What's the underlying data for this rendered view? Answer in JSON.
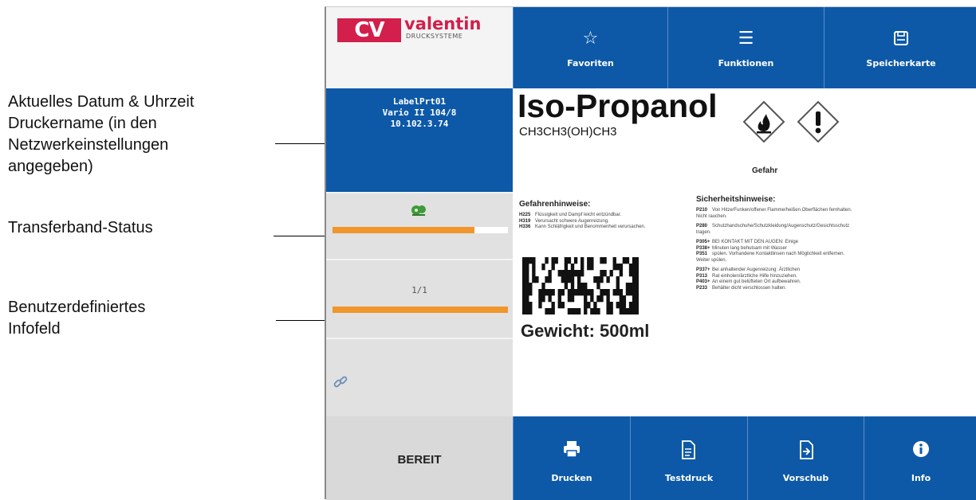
{
  "annotations": [
    {
      "lines": [
        "Aktuelles Datum & Uhrzeit",
        "Druckername (in den",
        "Netzwerkeinstellungen",
        "angegeben)"
      ]
    },
    {
      "lines": [
        "Transferband-Status"
      ]
    },
    {
      "lines": [
        "Benutzerdefiniertes",
        "Infofeld"
      ]
    }
  ],
  "logo": {
    "mark": "CV",
    "name": "valentin",
    "subtitle": "DRUCKSYSTEME",
    "color": "#d21f4b"
  },
  "top_buttons": [
    {
      "label": "Favoriten",
      "icon": "star-icon"
    },
    {
      "label": "Funktionen",
      "icon": "list-icon"
    },
    {
      "label": "Speicherkarte",
      "icon": "memory-card-icon"
    }
  ],
  "printer_info": {
    "name": "LabelPrt01",
    "model": "Vario II 104/8",
    "ip": "10.102.3.74"
  },
  "ribbon_status": {
    "icon": "ribbon-icon",
    "level": 0.81
  },
  "info_field": {
    "counter": "1/1",
    "progress": 1.0
  },
  "link_icon": "link-icon",
  "status": {
    "text": "BEREIT"
  },
  "label_preview": {
    "title": "Iso-Propanol",
    "formula": "CH3CH3(OH)CH3",
    "pictograms": [
      "flame-pictogram-icon",
      "exclamation-pictogram-icon"
    ],
    "signal_word": "Gefahr",
    "hazard_heading": "Gefahrenhinweise:",
    "hazard_statements": [
      {
        "code": "H225",
        "text": "Flüssigkeit und Dampf leicht entzündbar."
      },
      {
        "code": "H319",
        "text": "Verursacht schwere Augenreizung."
      },
      {
        "code": "H336",
        "text": "Kann Schläfrigkeit und Benommenheit verursachen."
      }
    ],
    "safety_heading": "Sicherheitshinweise:",
    "safety_statements": [
      {
        "code": "P210",
        "text": "Von Hitze/Funken/offener Flamme/heißen Oberflächen fernhalten. Nicht rauchen."
      },
      {
        "code": "P280",
        "text": "Schutzhandschuhe/Schutzkleidung/Augenschutz/Gesichtsschutz tragen."
      },
      {
        "code": "P305+",
        "text": "BEI KONTAKT MIT DEN AUGEN: Einige"
      },
      {
        "code": "P338+",
        "text": "Minuten lang behutsam mit Wasser"
      },
      {
        "code": "P351",
        "text": "spülen. Vorhandene Kontaktlinsen nach Möglichkeit entfernen. Weiter spülen."
      },
      {
        "code": "P337+",
        "text": "Bei anhaltender Augenreizung: Ärztlichen"
      },
      {
        "code": "P313",
        "text": "Rat einholen/ärztliche Hilfe hinzuziehen."
      },
      {
        "code": "P403+",
        "text": "An einem gut belüfteten Ort aufbewahren."
      },
      {
        "code": "P233",
        "text": "Behälter dicht verschlossen halten."
      }
    ],
    "weight": "Gewicht: 500ml"
  },
  "bottom_buttons": [
    {
      "label": "Drucken",
      "icon": "printer-icon"
    },
    {
      "label": "Testdruck",
      "icon": "test-print-icon"
    },
    {
      "label": "Vorschub",
      "icon": "feed-icon"
    },
    {
      "label": "Info",
      "icon": "info-icon"
    }
  ],
  "colors": {
    "primary_blue": "#0d59a8",
    "accent_orange": "#f0962a",
    "panel_gray": "#e1e1e1",
    "ribbon_green": "#3f9a3a"
  }
}
